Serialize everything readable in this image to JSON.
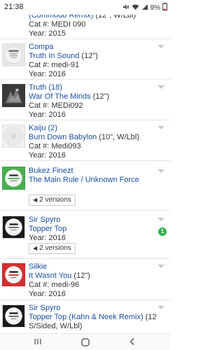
{
  "status": {
    "time": "21:38",
    "battery": "9%"
  },
  "releases": [
    {
      "artist": "",
      "title": "(Commodo Remix)",
      "format": "(12\", W/Lbl)",
      "cat_label": "Cat #:",
      "cat": "MEDI 090",
      "year_label": "Year:",
      "year": "2015"
    },
    {
      "artist": "Compa",
      "title": "Truth In Sound",
      "format": "(12\")",
      "cat_label": "Cat #:",
      "cat": "medi-91",
      "year_label": "Year:",
      "year": "2016"
    },
    {
      "artist": "Truth (18)",
      "title": "War Of The Minds",
      "format": "(12\")",
      "cat_label": "Cat #:",
      "cat": "MEDi092",
      "year_label": "Year:",
      "year": "2016"
    },
    {
      "artist": "Kaiju (2)",
      "title": "Burn Down Babylon",
      "format": "(10\", W/Lbl)",
      "cat_label": "Cat #:",
      "cat": "Medi093",
      "year_label": "Year:",
      "year": "2016"
    },
    {
      "artist": "Bukez Finezt",
      "title": "The Main Rule / Unknown Force",
      "versions": "2 versions"
    },
    {
      "artist": "Sir Spyro",
      "title": "Topper Top",
      "year_label": "Year:",
      "year": "2016",
      "versions": "2 versions",
      "badge": "1"
    },
    {
      "artist": "Silkie",
      "title": "It Wasnt You",
      "format": "(12\")",
      "cat_label": "Cat #:",
      "cat": "medi-96",
      "year_label": "Year:",
      "year": "2016"
    },
    {
      "artist": "Sir Spyro",
      "title": "Topper Top (Kahn & Neek Remix)",
      "format": "(12\",",
      "format2": "S/Sided, W/Lbl)"
    }
  ],
  "icons": {
    "recent": "recent-apps-icon",
    "home": "home-icon",
    "back": "back-icon"
  },
  "colors": {
    "link": "#1a4d9e",
    "badge": "#35b04a"
  }
}
